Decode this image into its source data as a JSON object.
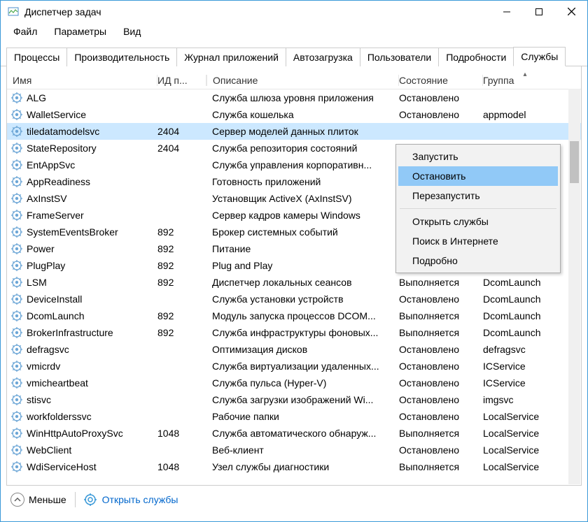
{
  "window": {
    "title": "Диспетчер задач"
  },
  "menu": {
    "file": "Файл",
    "options": "Параметры",
    "view": "Вид"
  },
  "tabs": {
    "processes": "Процессы",
    "performance": "Производительность",
    "apphistory": "Журнал приложений",
    "startup": "Автозагрузка",
    "users": "Пользователи",
    "details": "Подробности",
    "services": "Службы"
  },
  "columns": {
    "name": "Имя",
    "pid": "ИД п...",
    "description": "Описание",
    "state": "Состояние",
    "group": "Группа"
  },
  "rows": [
    {
      "name": "ALG",
      "pid": "",
      "desc": "Служба шлюза уровня приложения",
      "state": "Остановлено",
      "group": ""
    },
    {
      "name": "WalletService",
      "pid": "",
      "desc": "Служба кошелька",
      "state": "Остановлено",
      "group": "appmodel"
    },
    {
      "name": "tiledatamodelsvc",
      "pid": "2404",
      "desc": "Сервер моделей данных плиток",
      "state": "",
      "group": "",
      "selected": true
    },
    {
      "name": "StateRepository",
      "pid": "2404",
      "desc": "Служба репозитория состояний",
      "state": "",
      "group": ""
    },
    {
      "name": "EntAppSvc",
      "pid": "",
      "desc": "Служба управления корпоративн...",
      "state": "",
      "group": ""
    },
    {
      "name": "AppReadiness",
      "pid": "",
      "desc": "Готовность приложений",
      "state": "",
      "group": ""
    },
    {
      "name": "AxInstSV",
      "pid": "",
      "desc": "Установщик ActiveX (AxInstSV)",
      "state": "",
      "group": ""
    },
    {
      "name": "FrameServer",
      "pid": "",
      "desc": "Сервер кадров камеры Windows",
      "state": "",
      "group": ""
    },
    {
      "name": "SystemEventsBroker",
      "pid": "892",
      "desc": "Брокер системных событий",
      "state": "",
      "group": ""
    },
    {
      "name": "Power",
      "pid": "892",
      "desc": "Питание",
      "state": "",
      "group": ""
    },
    {
      "name": "PlugPlay",
      "pid": "892",
      "desc": "Plug and Play",
      "state": "Выполняется",
      "group": "DcomLaunch"
    },
    {
      "name": "LSM",
      "pid": "892",
      "desc": "Диспетчер локальных сеансов",
      "state": "Выполняется",
      "group": "DcomLaunch"
    },
    {
      "name": "DeviceInstall",
      "pid": "",
      "desc": "Служба установки устройств",
      "state": "Остановлено",
      "group": "DcomLaunch"
    },
    {
      "name": "DcomLaunch",
      "pid": "892",
      "desc": "Модуль запуска процессов DCOM...",
      "state": "Выполняется",
      "group": "DcomLaunch"
    },
    {
      "name": "BrokerInfrastructure",
      "pid": "892",
      "desc": "Служба инфраструктуры фоновых...",
      "state": "Выполняется",
      "group": "DcomLaunch"
    },
    {
      "name": "defragsvc",
      "pid": "",
      "desc": "Оптимизация дисков",
      "state": "Остановлено",
      "group": "defragsvc"
    },
    {
      "name": "vmicrdv",
      "pid": "",
      "desc": "Служба виртуализации удаленных...",
      "state": "Остановлено",
      "group": "ICService"
    },
    {
      "name": "vmicheartbeat",
      "pid": "",
      "desc": "Служба пульса (Hyper-V)",
      "state": "Остановлено",
      "group": "ICService"
    },
    {
      "name": "stisvc",
      "pid": "",
      "desc": "Служба загрузки изображений Wi...",
      "state": "Остановлено",
      "group": "imgsvc"
    },
    {
      "name": "workfolderssvc",
      "pid": "",
      "desc": "Рабочие папки",
      "state": "Остановлено",
      "group": "LocalService"
    },
    {
      "name": "WinHttpAutoProxySvc",
      "pid": "1048",
      "desc": "Служба автоматического обнаруж...",
      "state": "Выполняется",
      "group": "LocalService"
    },
    {
      "name": "WebClient",
      "pid": "",
      "desc": "Веб-клиент",
      "state": "Остановлено",
      "group": "LocalService"
    },
    {
      "name": "WdiServiceHost",
      "pid": "1048",
      "desc": "Узел службы диагностики",
      "state": "Выполняется",
      "group": "LocalService"
    }
  ],
  "context_menu": {
    "start": "Запустить",
    "stop": "Остановить",
    "restart": "Перезапустить",
    "open_services": "Открыть службы",
    "search_online": "Поиск в Интернете",
    "details": "Подробно"
  },
  "footer": {
    "less": "Меньше",
    "open_services": "Открыть службы"
  }
}
